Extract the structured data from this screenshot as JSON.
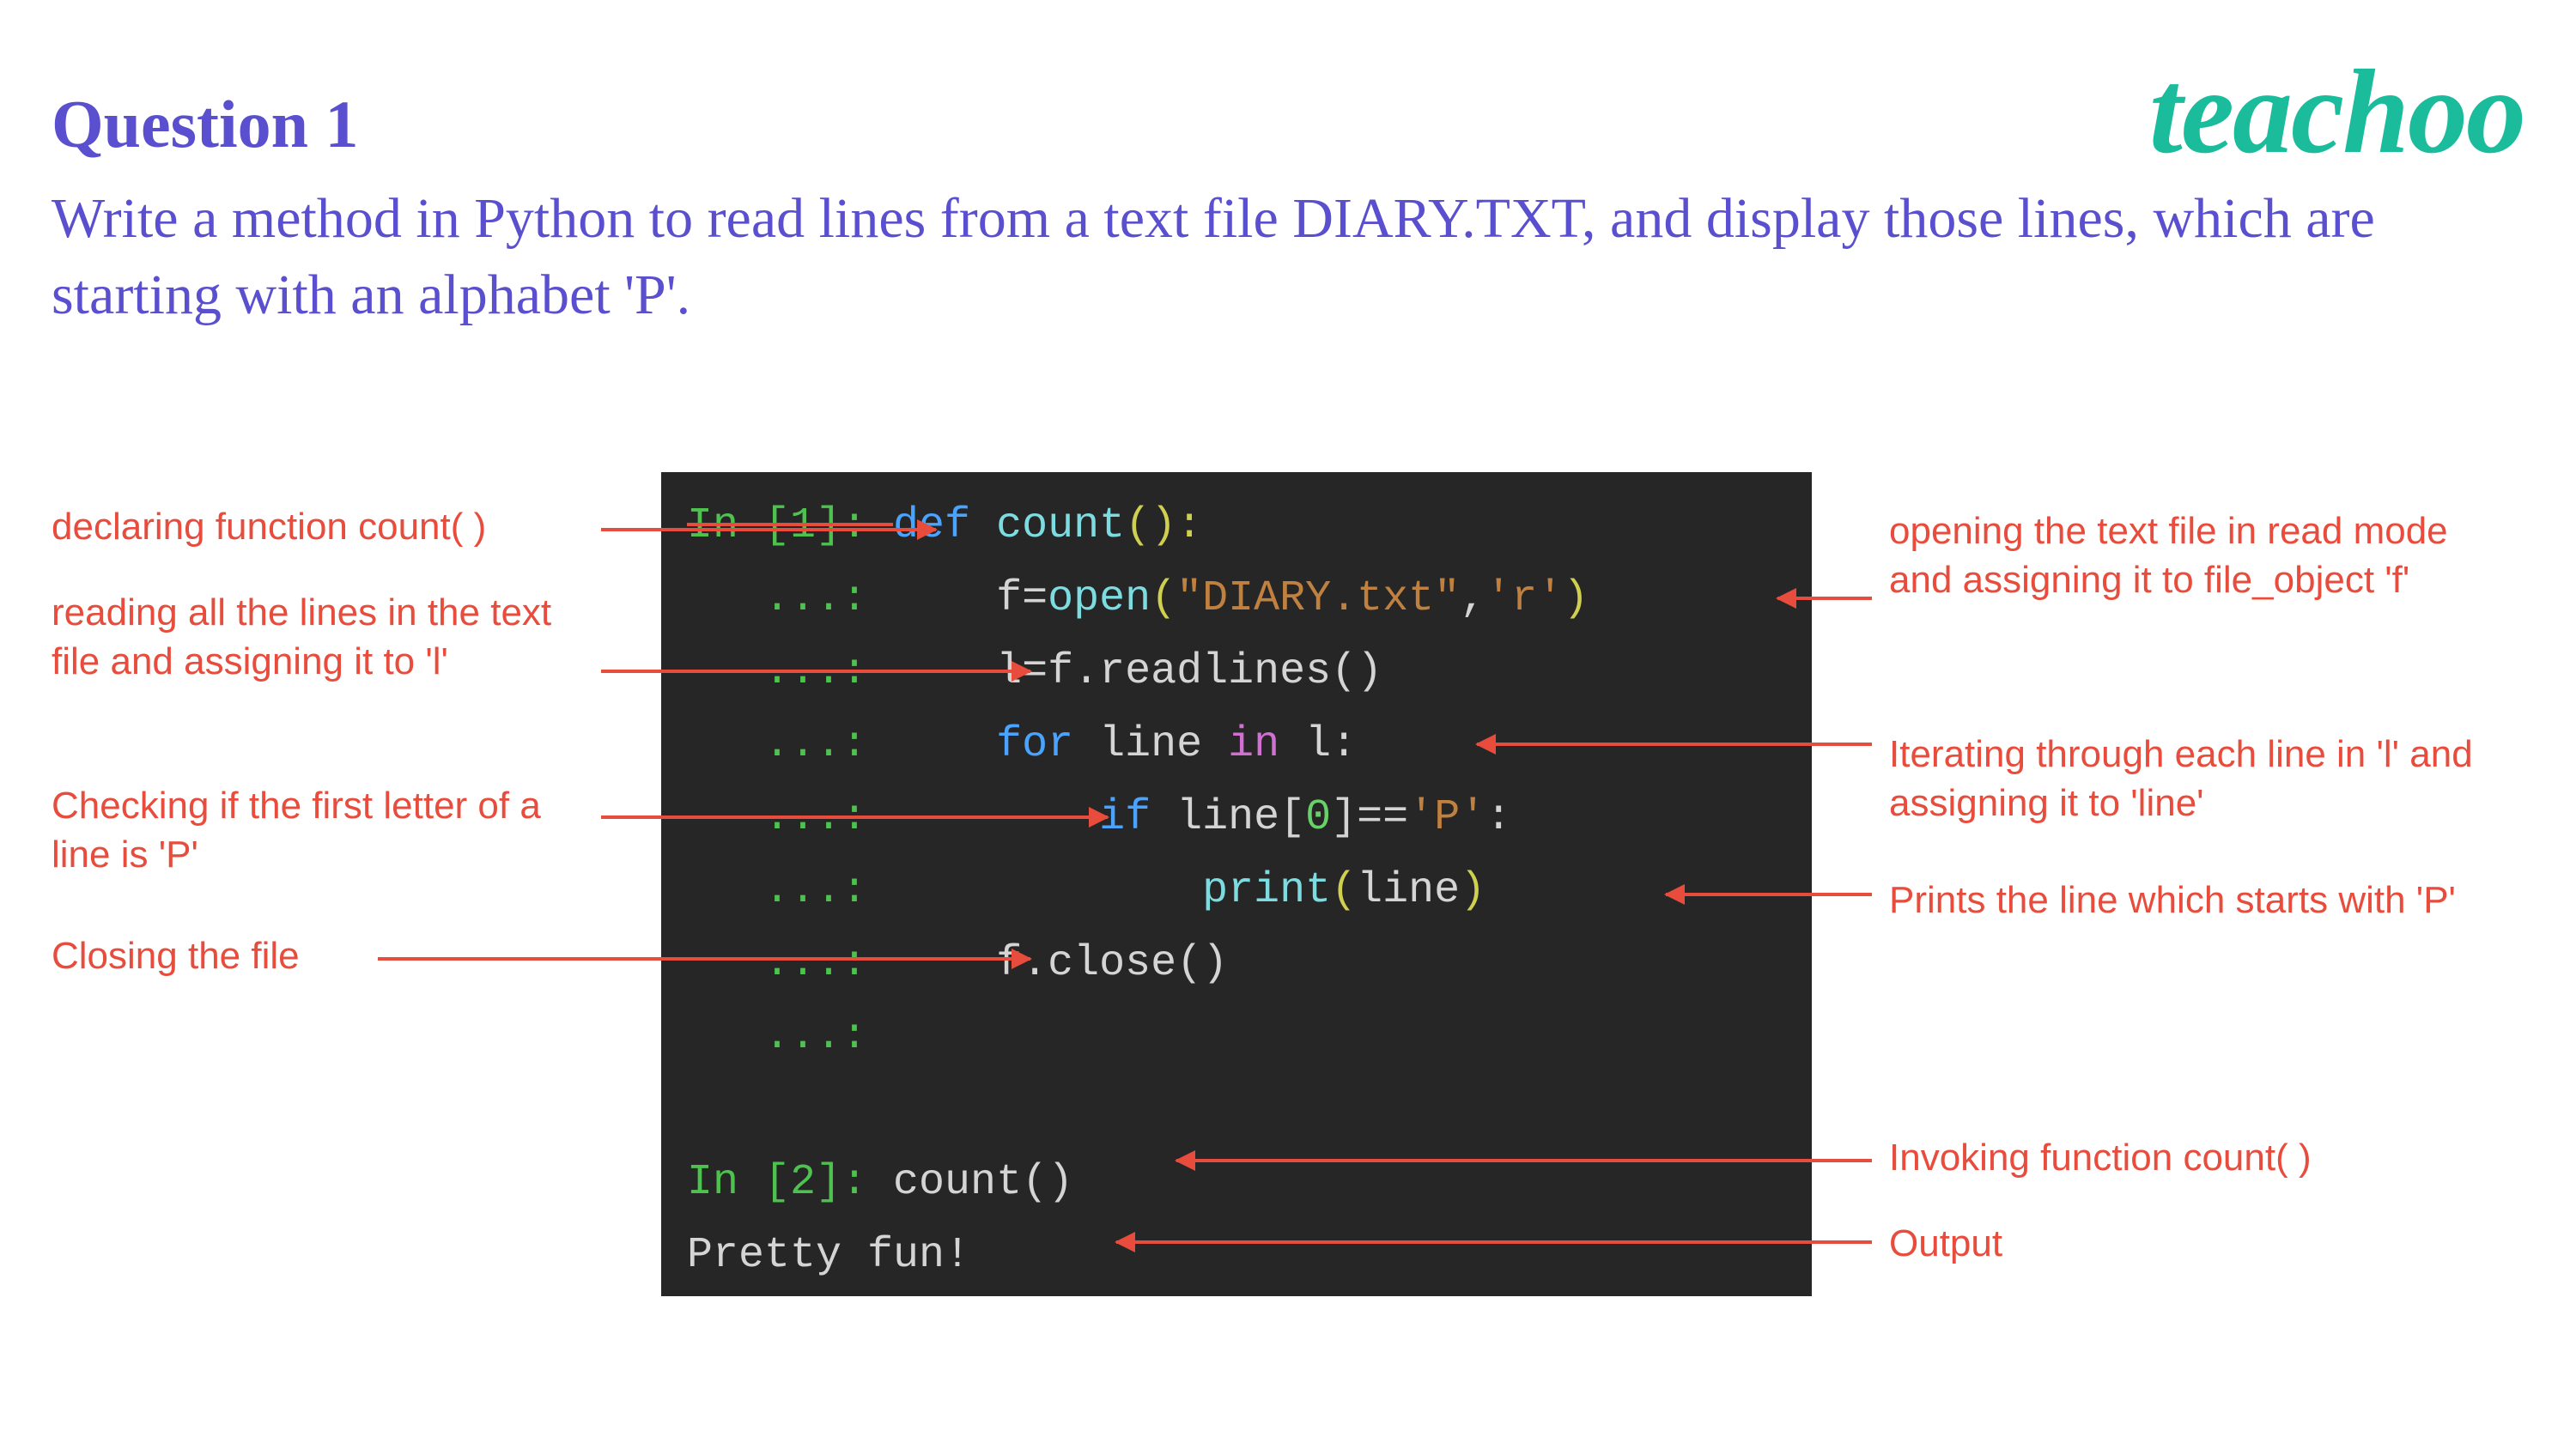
{
  "title": "Question 1",
  "question": "Write a method in Python to read lines from a text  file DIARY.TXT, and display those lines, which  are starting with an alphabet 'P'.",
  "logo": "teachoo",
  "code": {
    "l1_prompt": "In [1]: ",
    "l1_def": "def ",
    "l1_name": "count",
    "l1_paren": "():",
    "l2_dots": "   ...: ",
    "l2_code": "    f",
    "l2_op": "=",
    "l2_open": "open",
    "l2_p1": "(",
    "l2_str1": "\"DIARY.txt\"",
    "l2_comma": ",",
    "l2_str2": "'r'",
    "l2_p2": ")",
    "l3_dots": "   ...: ",
    "l3_code": "    l",
    "l3_op": "=",
    "l3_rest": "f.readlines()",
    "l4_dots": "   ...: ",
    "l4_for": "    for ",
    "l4_line": "line ",
    "l4_in": "in ",
    "l4_l": "l:",
    "l5_dots": "   ...: ",
    "l5_if": "        if ",
    "l5_cond": "line[",
    "l5_zero": "0",
    "l5_brk": "]",
    "l5_eq": "==",
    "l5_strp": "'P'",
    "l5_colon": ":",
    "l6_dots": "   ...: ",
    "l6_print": "            print",
    "l6_p1": "(",
    "l6_arg": "line",
    "l6_p2": ")",
    "l7_dots": "   ...: ",
    "l7_close": "    f.close()",
    "l8_dots": "   ...: ",
    "l9_blank": " ",
    "l10_prompt": "In [2]: ",
    "l10_call": "count()",
    "l11_out": "Pretty fun!"
  },
  "annotations": {
    "left": {
      "a1": "declaring function count( )",
      "a2": "reading all the lines in the text file and assigning it to 'l'",
      "a3": "Checking if the first letter of a line is 'P'",
      "a4": "Closing the file"
    },
    "right": {
      "a1": "opening the text file in read mode and assigning it to file_object 'f'",
      "a2": "Iterating through each line in 'l' and assigning it to 'line'",
      "a3": "Prints the line which starts with 'P'",
      "a4": "Invoking function count( )",
      "a5": "Output"
    }
  }
}
